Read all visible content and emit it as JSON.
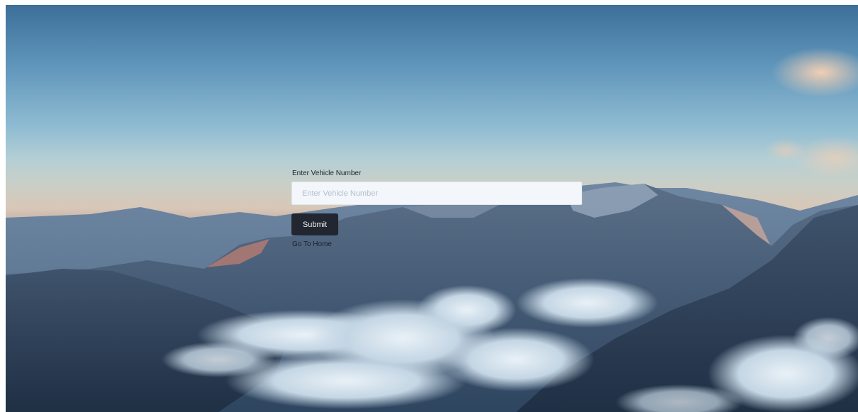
{
  "form": {
    "label": "Enter Vehicle Number",
    "placeholder": "Enter Vehicle Number",
    "value": "",
    "submit_label": "Submit",
    "home_link_label": "Go To Home"
  },
  "colors": {
    "submit_button_bg": "#222630",
    "input_bg": "#f3f6fa",
    "sky_top": "#3d6f98",
    "mountain_dark": "#2a3f56"
  }
}
